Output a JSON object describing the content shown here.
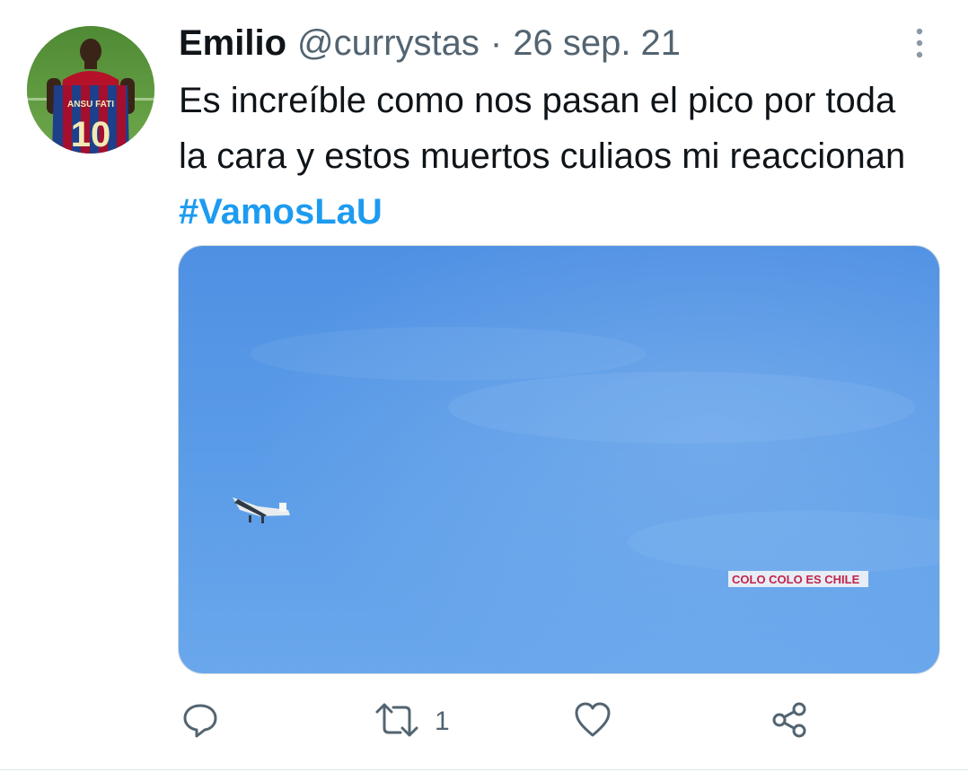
{
  "tweet": {
    "author_name": "Emilio",
    "handle": "@currystas",
    "separator": "·",
    "date": "26 sep. 21",
    "text_plain": "Es increíble como nos pasan el pico por toda la cara y estos muertos culiaos mi reaccionan",
    "hashtag": "#VamosLaU",
    "media_banner_text": "COLO COLO ES CHILE",
    "avatar_shirt_text": "ANSU FATI",
    "avatar_shirt_number": "10"
  },
  "actions": {
    "reply_icon": "reply-icon",
    "retweet_icon": "retweet-icon",
    "retweet_count": "1",
    "like_icon": "heart-icon",
    "share_icon": "share-icon"
  },
  "colors": {
    "hashtag": "#1d9bf0",
    "secondary_text": "#536471",
    "sky": "#5a9ae6"
  }
}
